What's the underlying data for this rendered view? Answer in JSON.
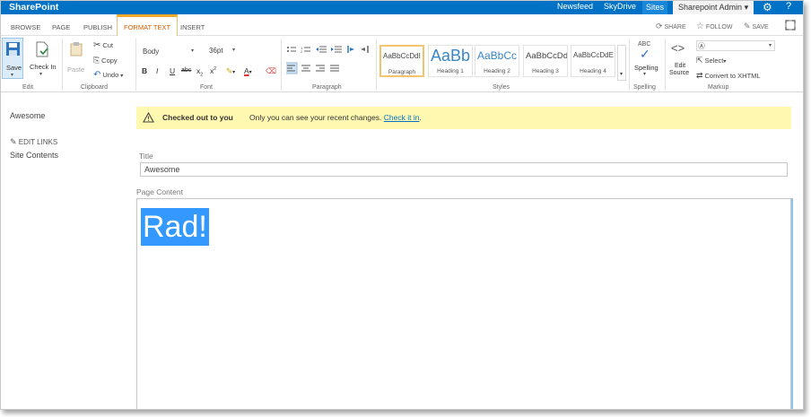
{
  "suite": {
    "brand": "SharePoint",
    "links": {
      "newsfeed": "Newsfeed",
      "skydrive": "SkyDrive",
      "sites": "Sites"
    },
    "user": "Sharepoint Admin",
    "user_caret": "▾",
    "gear_icon": "gear-icon",
    "help_icon": "help-icon"
  },
  "tabs": {
    "browse": "BROWSE",
    "page": "PAGE",
    "publish": "PUBLISH",
    "format_text": "FORMAT TEXT",
    "insert": "INSERT",
    "active_color": "#d25d00"
  },
  "page_actions": {
    "share": "SHARE",
    "follow": "FOLLOW",
    "save": "SAVE"
  },
  "ribbon": {
    "edit": {
      "save": "Save",
      "check_in": "Check In",
      "label": "Edit"
    },
    "clipboard": {
      "paste": "Paste",
      "cut": "Cut",
      "copy": "Copy",
      "undo": "Undo",
      "label": "Clipboard"
    },
    "font": {
      "family": "Body",
      "size": "36pt",
      "bold": "B",
      "italic": "I",
      "underline": "U",
      "strike": "abc",
      "subscript": "x",
      "sub_mark": "2",
      "superscript": "x",
      "sup_mark": "2",
      "font_color": "A",
      "label": "Font"
    },
    "paragraph": {
      "label": "Paragraph"
    },
    "styles": {
      "items": [
        {
          "sample": "AaBbCcDdI",
          "name": "Paragraph"
        },
        {
          "sample": "AaBb",
          "name": "Heading 1"
        },
        {
          "sample": "AaBbCc",
          "name": "Heading 2"
        },
        {
          "sample": "AaBbCcDd",
          "name": "Heading 3"
        },
        {
          "sample": "AaBbCcDdE",
          "name": "Heading 4"
        }
      ],
      "label": "Styles"
    },
    "spelling": {
      "abc": "ABC",
      "button": "Spelling",
      "label": "Spelling"
    },
    "markup": {
      "edit_source_1": "Edit",
      "edit_source_2": "Source",
      "select": "Select",
      "convert": "Convert to XHTML",
      "label": "Markup"
    }
  },
  "nav": {
    "site_title": "Awesome",
    "edit_links": "EDIT LINKS",
    "site_contents": "Site Contents"
  },
  "status": {
    "bold": "Checked out to you",
    "text": "Only you can see your recent changes.",
    "link": "Check it in",
    "end": ".",
    "color": "#fff8b0"
  },
  "form": {
    "title_label": "Title",
    "title_value": "Awesome",
    "content_label": "Page Content",
    "content_text": "Rad!"
  }
}
